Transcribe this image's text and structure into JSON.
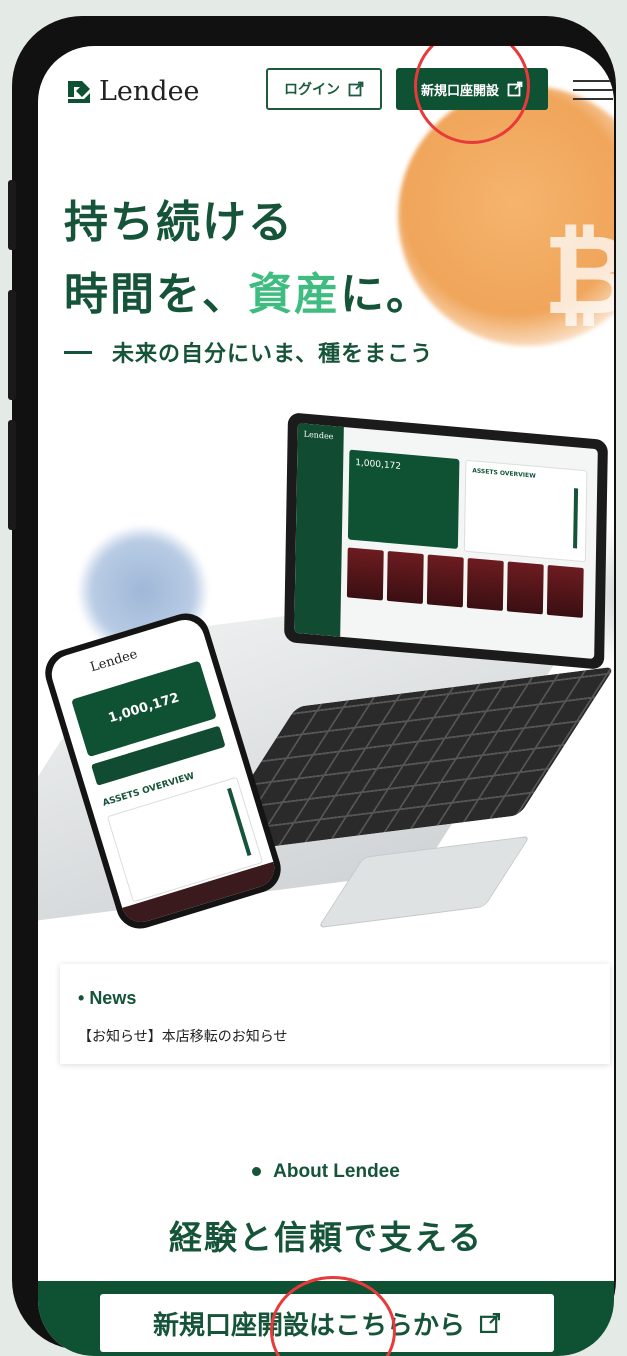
{
  "header": {
    "logo_text": "Lendee",
    "login_label": "ログイン",
    "signup_label": "新規口座開設"
  },
  "hero": {
    "line1": "持ち続ける",
    "line2_prefix": "時間を、",
    "line2_accent": "資産",
    "line2_suffix": "に。",
    "subline": "未来の自分にいま、種をまこう"
  },
  "laptop": {
    "logo": "Lendee",
    "balance": "1,000,172",
    "card_title": "ASSETS OVERVIEW"
  },
  "mock_phone": {
    "logo": "Lendee",
    "balance": "1,000,172",
    "section_title": "ASSETS OVERVIEW"
  },
  "news": {
    "heading": "News",
    "item": "【お知らせ】本店移転のお知らせ"
  },
  "about": {
    "label": "About Lendee",
    "title": "経験と信頼で支える"
  },
  "cta": {
    "label": "新規口座開設はこちらから"
  },
  "colors": {
    "brand_green": "#0f5133",
    "accent_green": "#3fbc7f",
    "highlight_red": "#e83a3a"
  }
}
